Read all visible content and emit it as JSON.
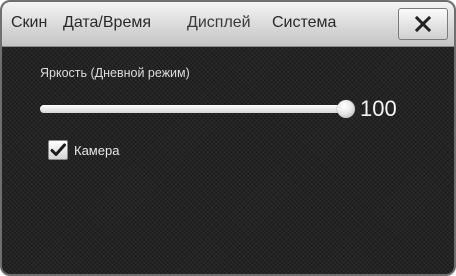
{
  "tabs": [
    {
      "label": "Скин"
    },
    {
      "label": "Дата/Время"
    },
    {
      "label": "Дисплей",
      "active": true
    },
    {
      "label": "Система"
    }
  ],
  "close_icon": "close-x-icon",
  "brightness": {
    "label": "Яркость (Дневной режим)",
    "value": 100,
    "value_text": "100",
    "min": 0,
    "max": 100
  },
  "camera": {
    "label": "Камера",
    "checked": true,
    "icon": "checkmark-icon"
  }
}
